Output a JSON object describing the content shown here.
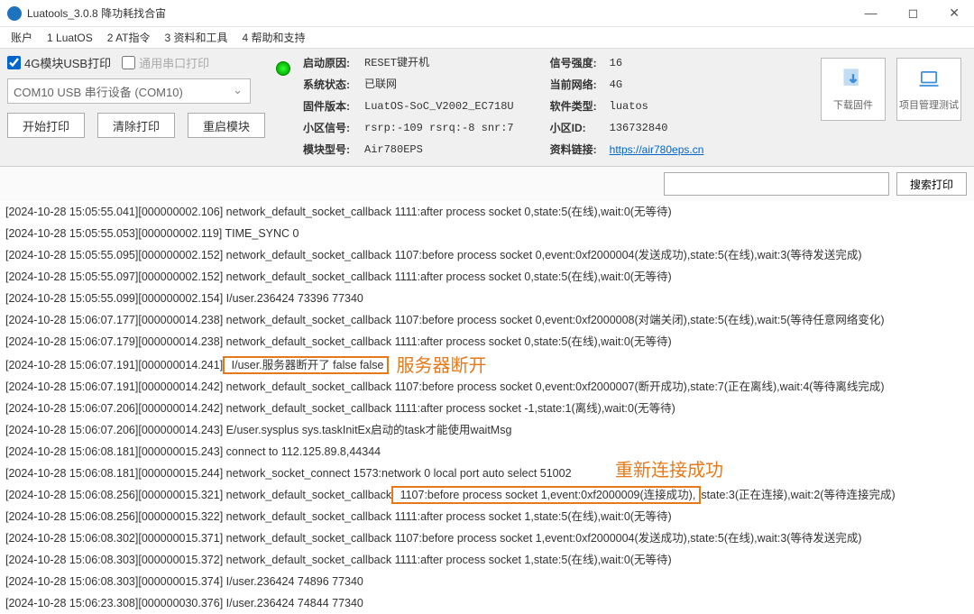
{
  "window": {
    "title": "Luatools_3.0.8 降功耗找合宙"
  },
  "menu": {
    "m1": "账户",
    "m2": "1 LuatOS",
    "m3": "2 AT指令",
    "m4": "3 资料和工具",
    "m5": "4 帮助和支持"
  },
  "checks": {
    "usb": "4G模块USB打印",
    "serial": "通用串口打印"
  },
  "combo": {
    "value": "COM10 USB 串行设备 (COM10)"
  },
  "buttons": {
    "start": "开始打印",
    "clear": "清除打印",
    "restart": "重启模块",
    "search": "搜索打印",
    "download": "下载固件",
    "project": "项目管理测试"
  },
  "info": {
    "left": [
      {
        "label": "启动原因:",
        "value": "RESET键开机"
      },
      {
        "label": "系统状态:",
        "value": "已联网"
      },
      {
        "label": "固件版本:",
        "value": "LuatOS-SoC_V2002_EC718U"
      },
      {
        "label": "小区信号:",
        "value": "rsrp:-109 rsrq:-8 snr:7"
      },
      {
        "label": "模块型号:",
        "value": "Air780EPS"
      }
    ],
    "right": [
      {
        "label": "信号强度:",
        "value": "16"
      },
      {
        "label": "当前网络:",
        "value": "4G"
      },
      {
        "label": "软件类型:",
        "value": "luatos"
      },
      {
        "label": "小区ID:",
        "value": "136732840"
      },
      {
        "label": "资料链接:",
        "value": "https://air780eps.cn",
        "link": true
      }
    ]
  },
  "annotations": {
    "a1": "服务器断开",
    "a2": "重新连接成功"
  },
  "log": [
    "[2024-10-28 15:05:55.041][000000002.106] network_default_socket_callback 1111:after process socket 0,state:5(在线),wait:0(无等待)",
    "[2024-10-28 15:05:55.053][000000002.119] TIME_SYNC 0",
    "[2024-10-28 15:05:55.095][000000002.152] network_default_socket_callback 1107:before process socket 0,event:0xf2000004(发送成功),state:5(在线),wait:3(等待发送完成)",
    "[2024-10-28 15:05:55.097][000000002.152] network_default_socket_callback 1111:after process socket 0,state:5(在线),wait:0(无等待)",
    "[2024-10-28 15:05:55.099][000000002.154] I/user.236424  73396   77340",
    "[2024-10-28 15:06:07.177][000000014.238] network_default_socket_callback 1107:before process socket 0,event:0xf2000008(对端关闭),state:5(在线),wait:5(等待任意网络变化)",
    "[2024-10-28 15:06:07.179][000000014.238] network_default_socket_callback 1111:after process socket 0,state:5(在线),wait:0(无等待)",
    {
      "prefix": "[2024-10-28 15:06:07.191][000000014.241]",
      "boxed": " I/user.服务器断开了        false     false",
      "annot": "a1"
    },
    "[2024-10-28 15:06:07.191][000000014.242] network_default_socket_callback 1107:before process socket 0,event:0xf2000007(断开成功),state:7(正在离线),wait:4(等待离线完成)",
    "[2024-10-28 15:06:07.206][000000014.242] network_default_socket_callback 1111:after process socket -1,state:1(离线),wait:0(无等待)",
    "[2024-10-28 15:06:07.206][000000014.243] E/user.sysplus sys.taskInitEx启动的task才能使用waitMsg",
    "[2024-10-28 15:06:08.181][000000015.243] connect to 112.125.89.8,44344",
    {
      "text": "[2024-10-28 15:06:08.181][000000015.244] network_socket_connect 1573:network 0 local port auto select 51002",
      "annot2": "a2"
    },
    {
      "prefix": "[2024-10-28 15:06:08.256][000000015.321] network_default_socket_callback",
      "boxed": " 1107:before process socket 1,event:0xf2000009(连接成功),",
      "suffix": "state:3(正在连接),wait:2(等待连接完成)"
    },
    "[2024-10-28 15:06:08.256][000000015.322] network_default_socket_callback 1111:after process socket 1,state:5(在线),wait:0(无等待)",
    "[2024-10-28 15:06:08.302][000000015.371] network_default_socket_callback 1107:before process socket 1,event:0xf2000004(发送成功),state:5(在线),wait:3(等待发送完成)",
    "[2024-10-28 15:06:08.303][000000015.372] network_default_socket_callback 1111:after process socket 1,state:5(在线),wait:0(无等待)",
    "[2024-10-28 15:06:08.303][000000015.374] I/user.236424  74896   77340",
    "[2024-10-28 15:06:23.308][000000030.376] I/user.236424  74844   77340"
  ]
}
